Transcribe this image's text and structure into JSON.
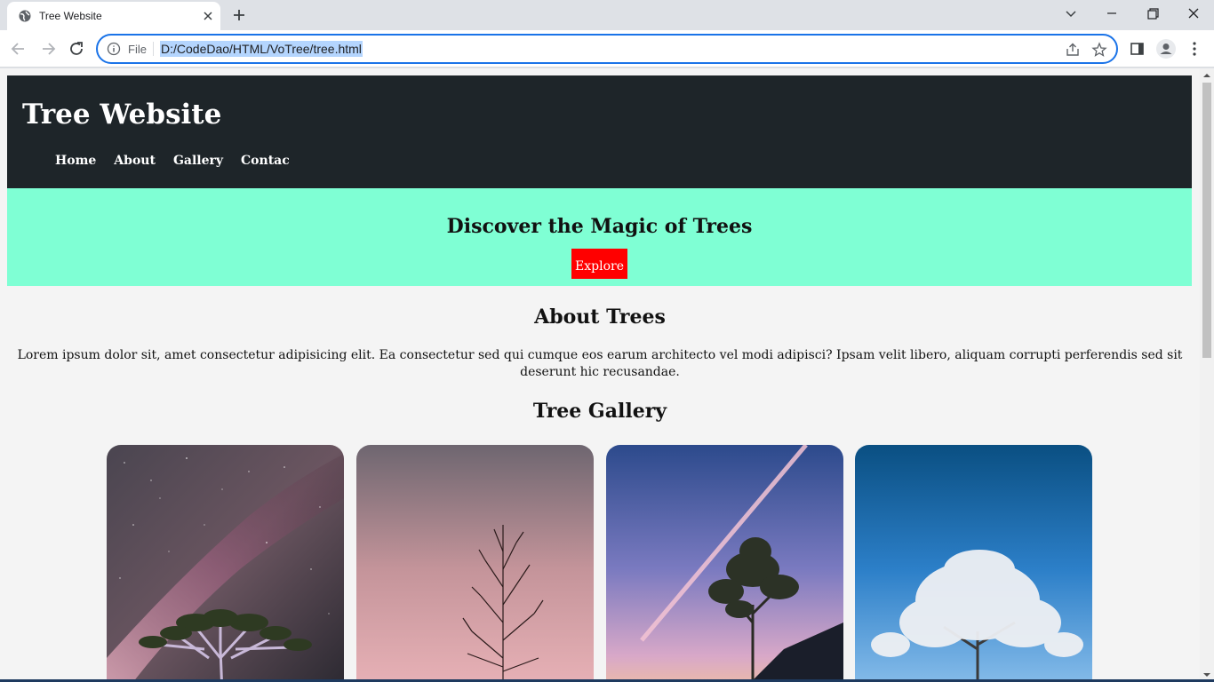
{
  "browser": {
    "tab_title": "Tree Website",
    "omnibox_prefix": "File",
    "url": "D:/CodeDao/HTML/VoTree/tree.html"
  },
  "site": {
    "title": "Tree Website",
    "nav": [
      "Home",
      "About",
      "Gallery",
      "Contac"
    ],
    "hero_heading": "Discover the Magic of Trees",
    "hero_button": "Explore",
    "about_heading": "About Trees",
    "about_text": "Lorem ipsum dolor sit, amet consectetur adipisicing elit. Ea consectetur sed qui cumque eos earum architecto vel modi adipisci? Ipsam velit libero, aliquam corrupti perferendis sed sit deserunt hic recusandae.",
    "gallery_heading": "Tree Gallery"
  },
  "colors": {
    "header_bg": "#1e2529",
    "hero_bg": "#7fffd4",
    "button_bg": "#ff0000",
    "page_bg": "#f4f4f4",
    "omnibox_focus": "#1a73e8"
  },
  "gallery_images": [
    "night-sky-dragon-tree",
    "bare-tree-pink-sky",
    "tree-contrail-sunset",
    "frosted-tree-blue-sky"
  ]
}
